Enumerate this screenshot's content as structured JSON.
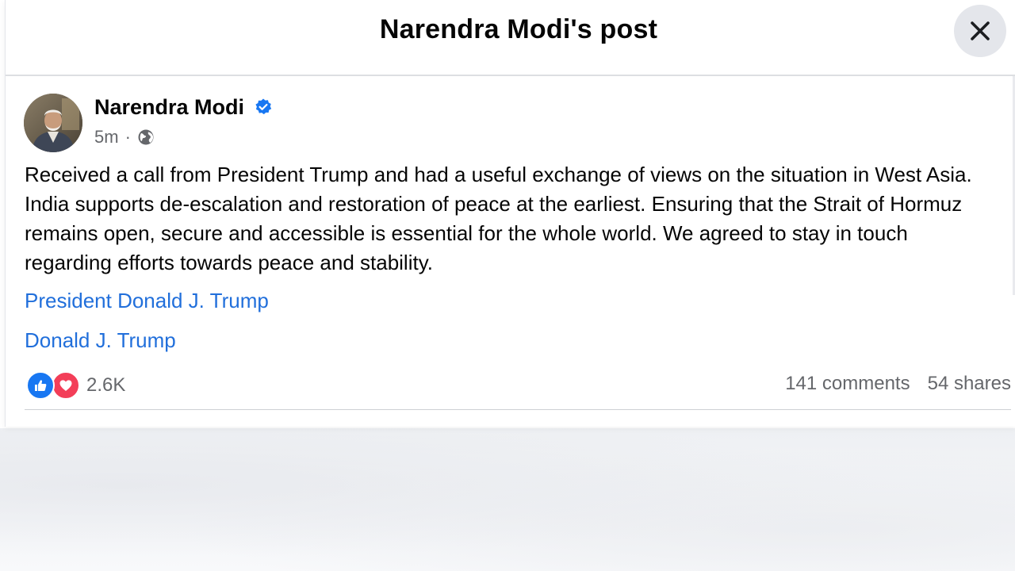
{
  "dialog": {
    "title": "Narendra Modi's post",
    "close_icon": "close-icon"
  },
  "post": {
    "author": "Narendra Modi",
    "verified_icon": "verified-badge-icon",
    "time": "5m",
    "separator": "·",
    "privacy_icon": "globe-icon",
    "text": "Received a call from President Trump and had a useful exchange of views on the situation in West Asia. India supports de-escalation and restoration of peace at the earliest. Ensuring that the Strait of Hormuz remains open, secure and accessible is essential for the whole world. We agreed to stay in touch regarding efforts towards peace and stability.",
    "tags": [
      {
        "label": "President Donald J. Trump"
      },
      {
        "label": "Donald J. Trump"
      }
    ],
    "reactions": {
      "icons": [
        "like-icon",
        "love-icon"
      ],
      "count": "2.6K"
    },
    "comments": "141 comments",
    "shares": "54 shares"
  },
  "colors": {
    "link": "#216fdb",
    "like": "#1877f2",
    "love": "#f33e58",
    "verified": "#1877f2",
    "secondary_text": "#65676b"
  }
}
